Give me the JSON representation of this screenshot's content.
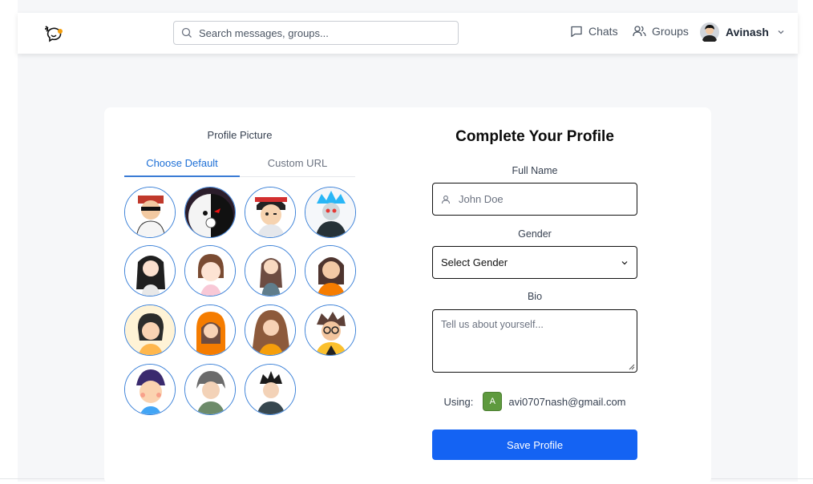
{
  "header": {
    "search_placeholder": "Search messages, groups...",
    "nav": [
      {
        "label": "Chats",
        "icon": "chat-icon"
      },
      {
        "label": "Groups",
        "icon": "users-icon"
      }
    ],
    "user": {
      "name": "Avinash",
      "avatar": "user-avatar"
    }
  },
  "profile_picture": {
    "label": "Profile Picture",
    "tabs": [
      {
        "label": "Choose Default",
        "active": true
      },
      {
        "label": "Custom URL",
        "active": false
      }
    ],
    "avatars_count": 15
  },
  "form": {
    "title": "Complete Your Profile",
    "full_name": {
      "label": "Full Name",
      "placeholder": "John Doe"
    },
    "gender": {
      "label": "Gender",
      "selected": "Select Gender"
    },
    "bio": {
      "label": "Bio",
      "placeholder": "Tell us about yourself..."
    },
    "using": {
      "label": "Using:",
      "initial": "A",
      "email": "avi0707nash@gmail.com"
    },
    "save_label": "Save Profile"
  },
  "colors": {
    "primary": "#1463f3",
    "tab_active": "#1d6fd6",
    "avatar_border": "#3d82d8",
    "initial_badge": "#5e9a3e"
  }
}
